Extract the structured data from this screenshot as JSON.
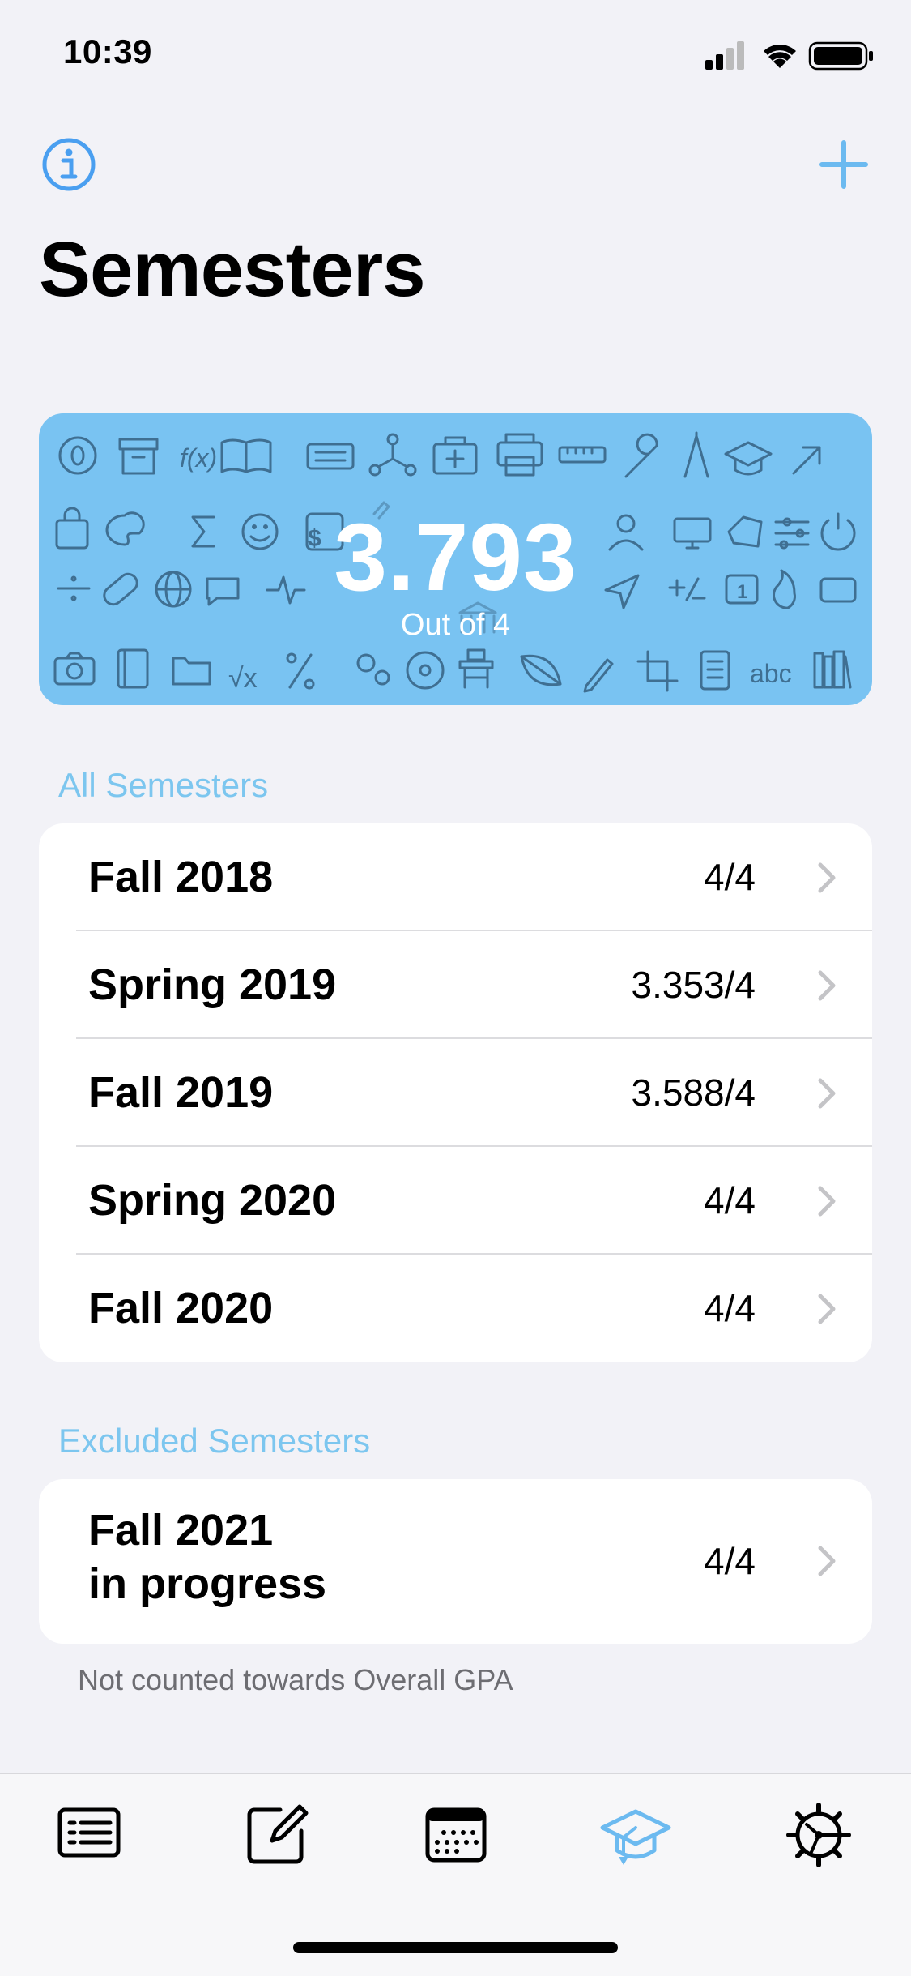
{
  "status_bar": {
    "time": "10:39"
  },
  "nav": {
    "title": "Semesters"
  },
  "overall": {
    "gpa": "3.793",
    "subtitle": "Out of 4"
  },
  "sections": {
    "all_header": "All Semesters",
    "excluded_header": "Excluded Semesters",
    "excluded_note": "Not counted towards Overall GPA"
  },
  "semesters": [
    {
      "name": "Fall 2018",
      "gpa": "4/4"
    },
    {
      "name": "Spring 2019",
      "gpa": "3.353/4"
    },
    {
      "name": "Fall 2019",
      "gpa": "3.588/4"
    },
    {
      "name": "Spring 2020",
      "gpa": "4/4"
    },
    {
      "name": "Fall 2020",
      "gpa": "4/4"
    }
  ],
  "excluded": [
    {
      "name_line1": "Fall 2021",
      "name_line2": "in progress",
      "gpa": "4/4"
    }
  ],
  "card_pattern_text": {
    "fx": "f(x)",
    "abc": "abc",
    "sqrt": "√x"
  },
  "tabs": [
    {
      "icon": "list-icon"
    },
    {
      "icon": "compose-icon"
    },
    {
      "icon": "calendar-icon"
    },
    {
      "icon": "graduation-cap-icon",
      "active": true
    },
    {
      "icon": "settings-gear-icon"
    }
  ],
  "colors": {
    "accent": "#4a9ff0",
    "card": "#79c3f2",
    "section_header": "#7cc6ef"
  }
}
